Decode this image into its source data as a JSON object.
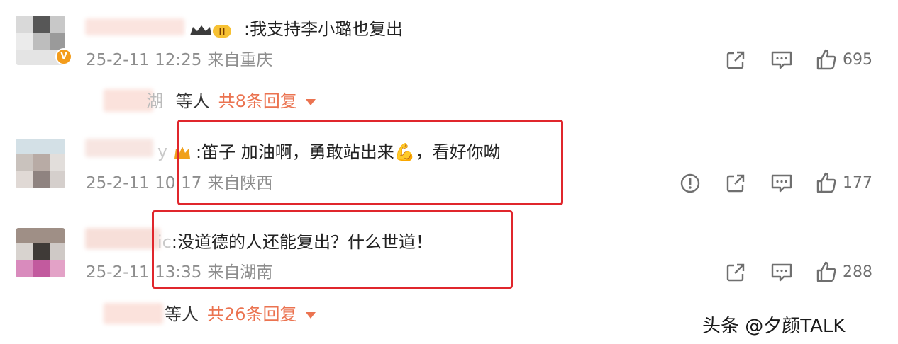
{
  "comments": [
    {
      "text": ":我支持李小璐也复出",
      "date": "25-2-11 12:25",
      "location": "来自重庆",
      "likes": "695",
      "replies": {
        "suffix": "等人",
        "count": "共8条回复",
        "name_fragment": "湖"
      }
    },
    {
      "text": ":笛子 加油啊，勇敢站出来",
      "text_emoji": "💪",
      "text_tail": "，看好你呦",
      "name_fragment": "y",
      "date": "25-2-11 10:17",
      "location": "来自陕西",
      "likes": "177"
    },
    {
      "text": ":没道德的人还能复出？什么世道！",
      "name_fragment": "ic",
      "date": "25-2-11 13:35",
      "location": "来自湖南",
      "likes": "288",
      "replies": {
        "suffix": "等人",
        "count": "共26条回复"
      }
    }
  ],
  "icons": [
    "share-icon",
    "comment-icon",
    "like-icon",
    "report-icon"
  ],
  "colors": {
    "accent": "#eb7350",
    "highlight": "#e0262c",
    "meta": "#8d8d8d"
  },
  "watermark": "头条 @夕颜TALK"
}
